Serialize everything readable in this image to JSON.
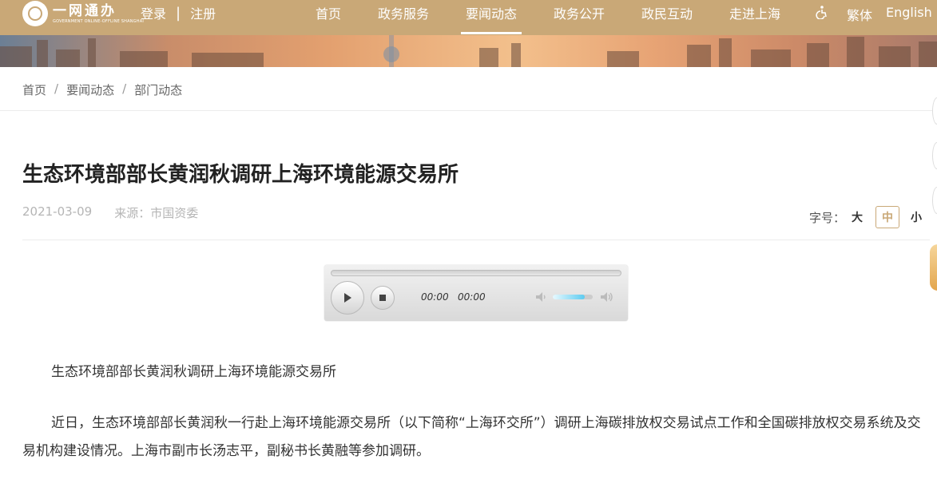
{
  "header": {
    "logo": {
      "cn": "一网通办",
      "en": "GOVERNMENT ONLINE-OFFLINE SHANGHAI"
    },
    "login": "登录",
    "separator": "|",
    "register": "注册",
    "nav": [
      {
        "label": "首页",
        "active": false
      },
      {
        "label": "政务服务",
        "active": false
      },
      {
        "label": "要闻动态",
        "active": true
      },
      {
        "label": "政务公开",
        "active": false
      },
      {
        "label": "政民互动",
        "active": false
      },
      {
        "label": "走进上海",
        "active": false
      }
    ],
    "accessibility_icon": "wheelchair-icon",
    "traditional": "繁体",
    "english": "English"
  },
  "breadcrumb": {
    "items": [
      "首页",
      "要闻动态",
      "部门动态"
    ],
    "separator": "/"
  },
  "article": {
    "title": "生态环境部部长黄润秋调研上海环境能源交易所",
    "date": "2021-03-09",
    "source": "来源：市国资委",
    "font_size": {
      "label": "字号：",
      "options": [
        "大",
        "中",
        "小"
      ],
      "selected": "中"
    },
    "paragraphs": [
      "生态环境部部长黄润秋调研上海环境能源交易所",
      "近日，生态环境部部长黄润秋一行赴上海环境能源交易所（以下简称“上海环交所”）调研上海碳排放权交易试点工作和全国碳排放权交易系统及交易机构建设情况。上海市副市长汤志平，副秘书长黄融等参加调研。"
    ]
  },
  "audio_player": {
    "current_time": "00:00",
    "duration": "00:00",
    "volume": 0.8
  },
  "colors": {
    "brand": "#c9a877",
    "title": "#222222",
    "meta": "#b5b5b5"
  }
}
